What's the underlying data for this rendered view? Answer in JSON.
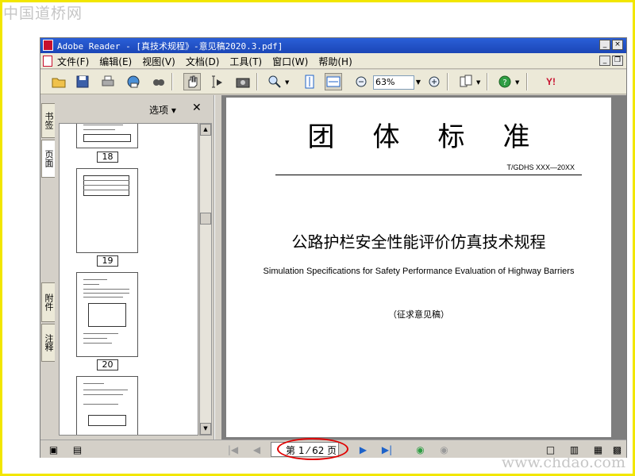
{
  "watermarks": {
    "top": "中国道桥网",
    "bottom": "www.chdao.com"
  },
  "window": {
    "title": "Adobe Reader - [真技术规程》-意见稿2020.3.pdf]",
    "buttons": {
      "minimize": "_",
      "restore": "❐",
      "close": "×"
    }
  },
  "menu": {
    "items": [
      "文件(F)",
      "编辑(E)",
      "视图(V)",
      "文档(D)",
      "工具(T)",
      "窗口(W)",
      "帮助(H)"
    ]
  },
  "toolbar": {
    "zoom_value": "63%",
    "icons": [
      "open-icon",
      "save-icon",
      "print-icon",
      "email-icon",
      "search-icon",
      "hand-icon",
      "select-text-icon",
      "snapshot-icon",
      "zoom-in-icon",
      "fit-page-icon",
      "fit-width-icon",
      "zoom-out-minus-icon",
      "zoom-plus-icon",
      "page-display-icon",
      "help-icon",
      "yahoo-icon"
    ],
    "yahoo_label": "Y!"
  },
  "side_tabs": {
    "bookmarks": "书签",
    "pages": "页面",
    "attachments": "附件",
    "comments": "注释"
  },
  "nav_panel": {
    "options_label": "选项 ▾",
    "close_label": "✕",
    "thumbnails": [
      {
        "page_label": "18"
      },
      {
        "page_label": "19"
      },
      {
        "page_label": "20"
      }
    ]
  },
  "document": {
    "heading": "团体标准",
    "code": "T/GDHS XXX—20XX",
    "title_cn": "公路护栏安全性能评价仿真技术规程",
    "title_en": "Simulation Specifications for Safety Performance Evaluation of Highway Barriers",
    "draft_note": "（征求意见稿）"
  },
  "statusbar": {
    "page_indicator": "第 1 ⁄ 62 页"
  },
  "colors": {
    "frame": "#f2e600",
    "titlebar": "#1b46b6",
    "highlight": "#e00000"
  }
}
